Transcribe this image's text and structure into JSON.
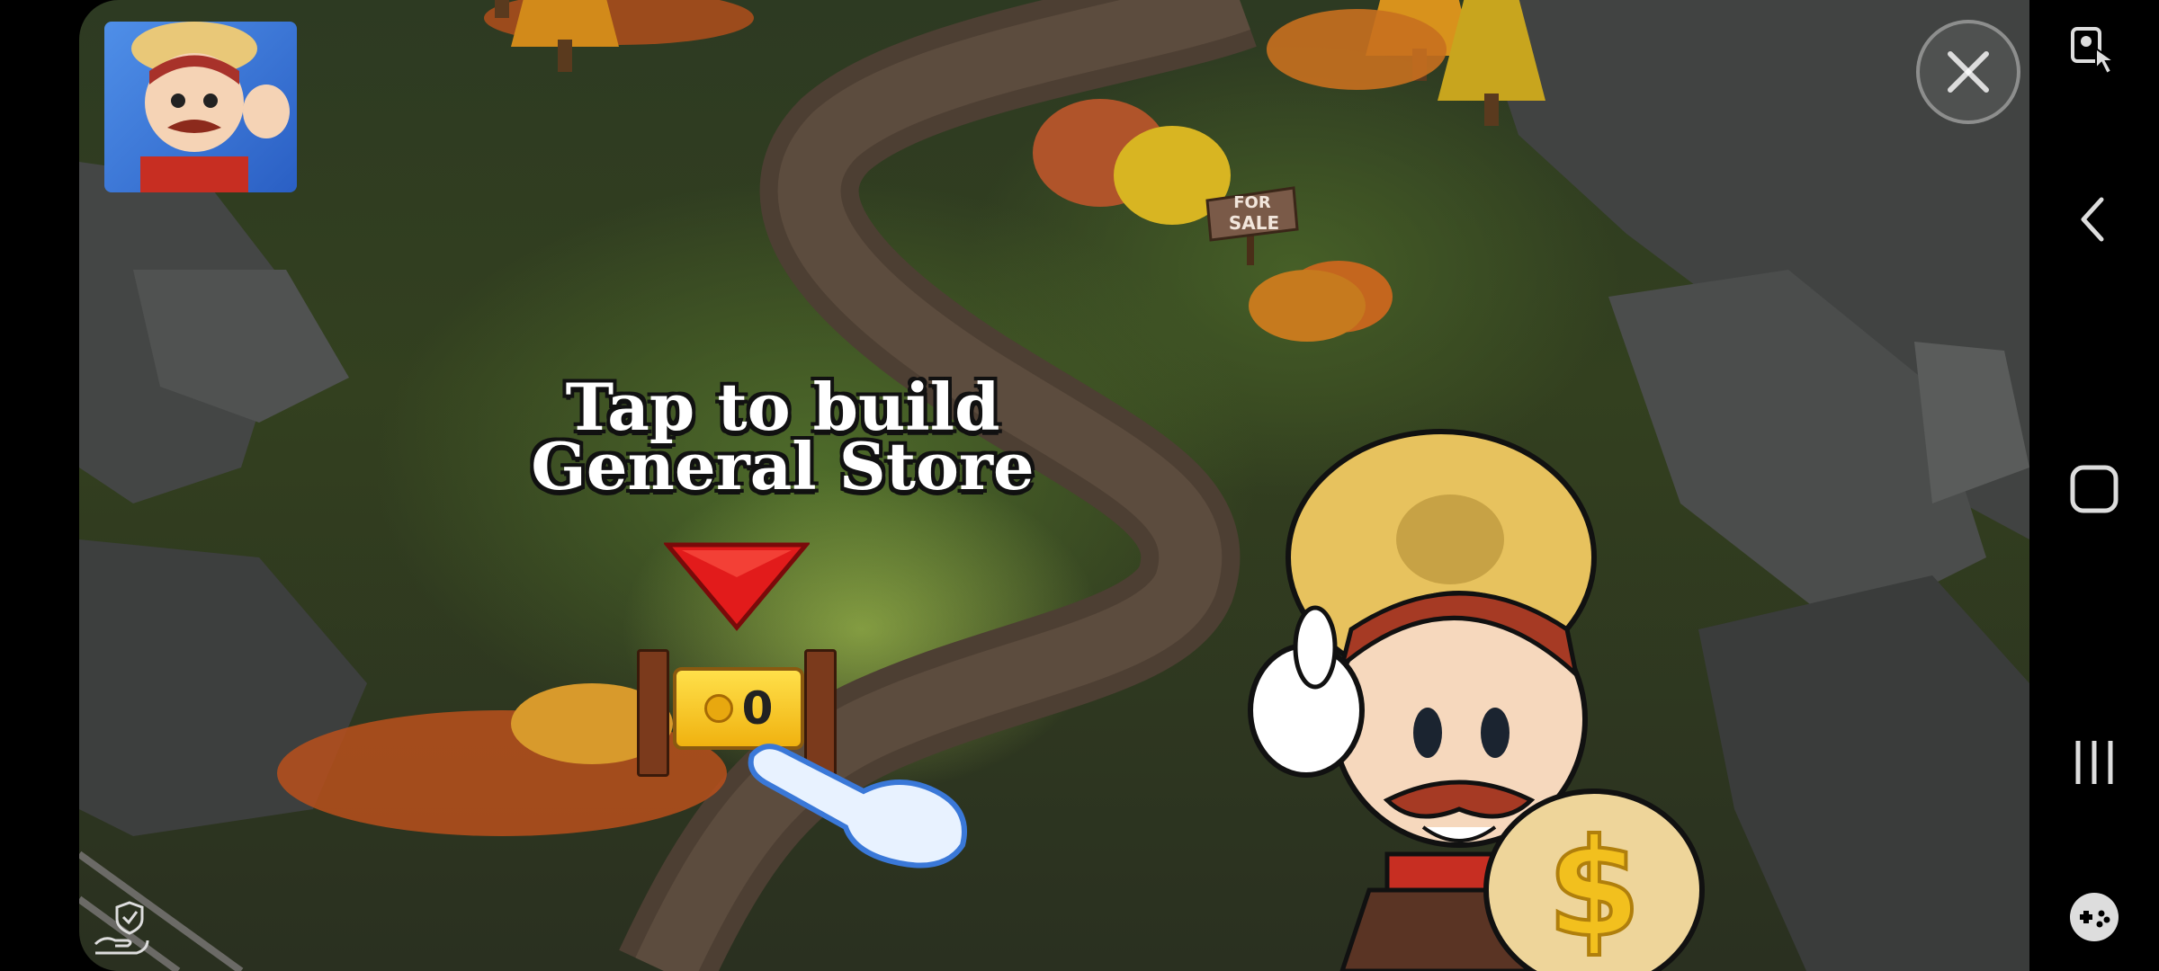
{
  "game": {
    "prompt_line1": "Tap to build",
    "prompt_line2": "General Store",
    "build_cost": "0",
    "sign_line1": "FOR",
    "sign_line2": "SALE"
  },
  "icons": {
    "avatar": "player-avatar-icon",
    "close": "close-icon",
    "arrow": "down-arrow-icon",
    "coin": "coin-icon",
    "hand": "pointing-hand-icon",
    "privacy": "privacy-shield-hand-icon",
    "nav_screenshot": "screenshot-pointer-icon",
    "nav_back": "back-icon",
    "nav_home": "home-icon",
    "nav_recents": "recents-icon",
    "nav_game_tools": "game-tools-icon"
  },
  "colors": {
    "arrow": "#e21b1b",
    "badge": "#f5c21a",
    "navbar": "#000000"
  }
}
